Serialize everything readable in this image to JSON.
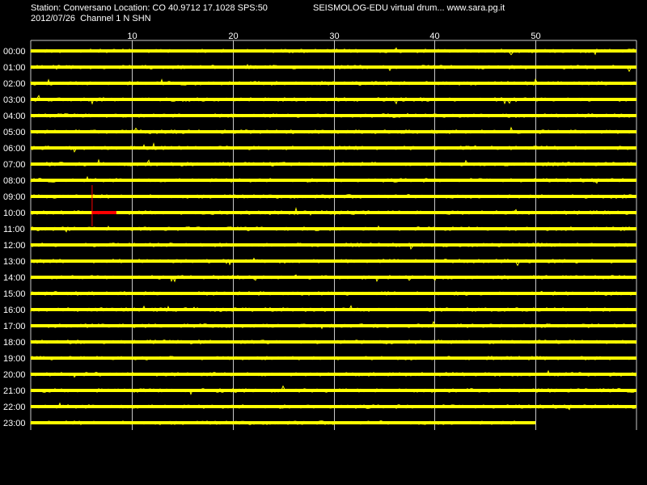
{
  "header": {
    "station_line": "Station: Conversano Location: CO 40.9712 17.1028 SPS:50",
    "date_line": "2012/07/26  Channel 1 N SHN",
    "app_line": "SEISMOLOG-EDU virtual drum... www.sara.pg.it"
  },
  "colors": {
    "background": "#000000",
    "trace": "#ffff00",
    "grid": "#c8c8c8",
    "text": "#ffffff",
    "marker": "#ff0000"
  },
  "chart_data": {
    "type": "line",
    "title": "",
    "xlabel": "",
    "ylabel": "",
    "x_unit": "minutes",
    "xlim": [
      0,
      60
    ],
    "x_ticks": [
      10,
      20,
      30,
      40,
      50
    ],
    "grid": true,
    "row_labels": [
      "00:00",
      "01:00",
      "02:00",
      "03:00",
      "04:00",
      "05:00",
      "06:00",
      "07:00",
      "08:00",
      "09:00",
      "10:00",
      "11:00",
      "12:00",
      "13:00",
      "14:00",
      "15:00",
      "16:00",
      "17:00",
      "18:00",
      "19:00",
      "20:00",
      "21:00",
      "22:00",
      "23:00"
    ],
    "last_row_end_minute": 50,
    "marker": {
      "row": "10:00",
      "start_minute": 6,
      "end_minute": 8
    }
  }
}
